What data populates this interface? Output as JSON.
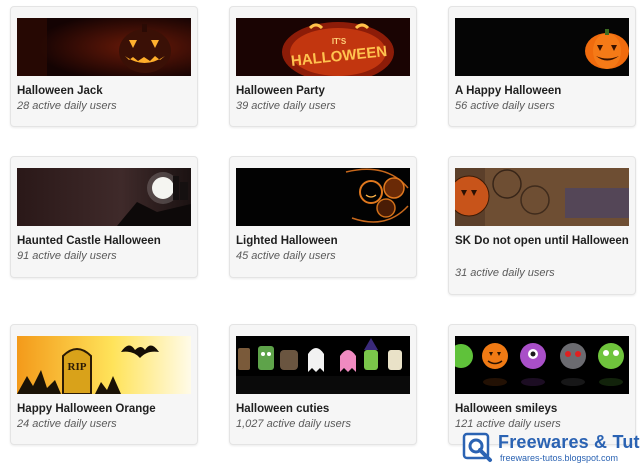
{
  "themes": [
    {
      "title": "Halloween Jack",
      "users": "28 active daily users",
      "image": "jack-o-lantern-dark"
    },
    {
      "title": "Halloween Party",
      "users": "39 active daily users",
      "image": "its-halloween-pumpkin"
    },
    {
      "title": "A Happy Halloween",
      "users": "56 active daily users",
      "image": "pumpkin-on-black"
    },
    {
      "title": "Haunted Castle Halloween",
      "users": "91 active daily users",
      "image": "haunted-castle-moon"
    },
    {
      "title": "Lighted Halloween",
      "users": "45 active daily users",
      "image": "lighted-pumpkins"
    },
    {
      "title": "SK Do not open until Halloween",
      "users": "31 active daily users",
      "image": "vintage-stamp-pumpkin"
    },
    {
      "title": "Happy Halloween Orange",
      "users": "24 active daily users",
      "image": "rip-tombstone-bat"
    },
    {
      "title": "Halloween cuties",
      "users": "1,027 active daily users",
      "image": "cute-monsters-row"
    },
    {
      "title": "Halloween smileys",
      "users": "121 active daily users",
      "image": "monster-smileys-row"
    }
  ],
  "watermark": {
    "title": "Freewares & Tutos",
    "url": "freewares-tutos.blogspot.com",
    "color": "#2b63b3"
  }
}
